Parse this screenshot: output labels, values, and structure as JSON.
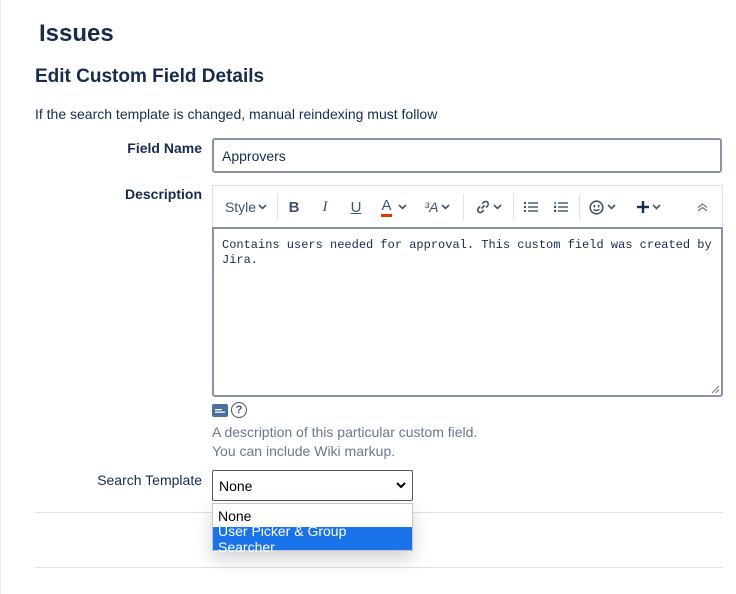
{
  "page": {
    "title": "Issues",
    "section_title": "Edit Custom Field Details",
    "notice": "If the search template is changed, manual reindexing must follow"
  },
  "form": {
    "field_name": {
      "label": "Field Name",
      "value": "Approvers"
    },
    "description": {
      "label": "Description",
      "value": "Contains users needed for approval. This custom field was created by Jira.",
      "hint_line1": "A description of this particular custom field.",
      "hint_line2": "You can include Wiki markup."
    },
    "search_template": {
      "label": "Search Template",
      "selected": "None",
      "options": [
        "None",
        "User Picker & Group Searcher"
      ],
      "highlighted_index": 1
    }
  },
  "toolbar": {
    "style_label": "Style",
    "bold_label": "B",
    "italic_label": "I",
    "underline_label": "U",
    "text_color_label": "A",
    "text_color": "#de350b",
    "more_format_label": "³A",
    "link_icon": "link-icon",
    "bullet_list_icon": "bullet-list-icon",
    "numbered_list_icon": "numbered-list-icon",
    "emoji_icon": "emoji-icon",
    "insert_icon": "plus-icon",
    "collapse_icon": "collapse-icon"
  },
  "colors": {
    "text_primary": "#172b4d",
    "text_subtle": "#6b778c",
    "input_border": "#8993a4",
    "option_highlight": "#1a73e8"
  }
}
